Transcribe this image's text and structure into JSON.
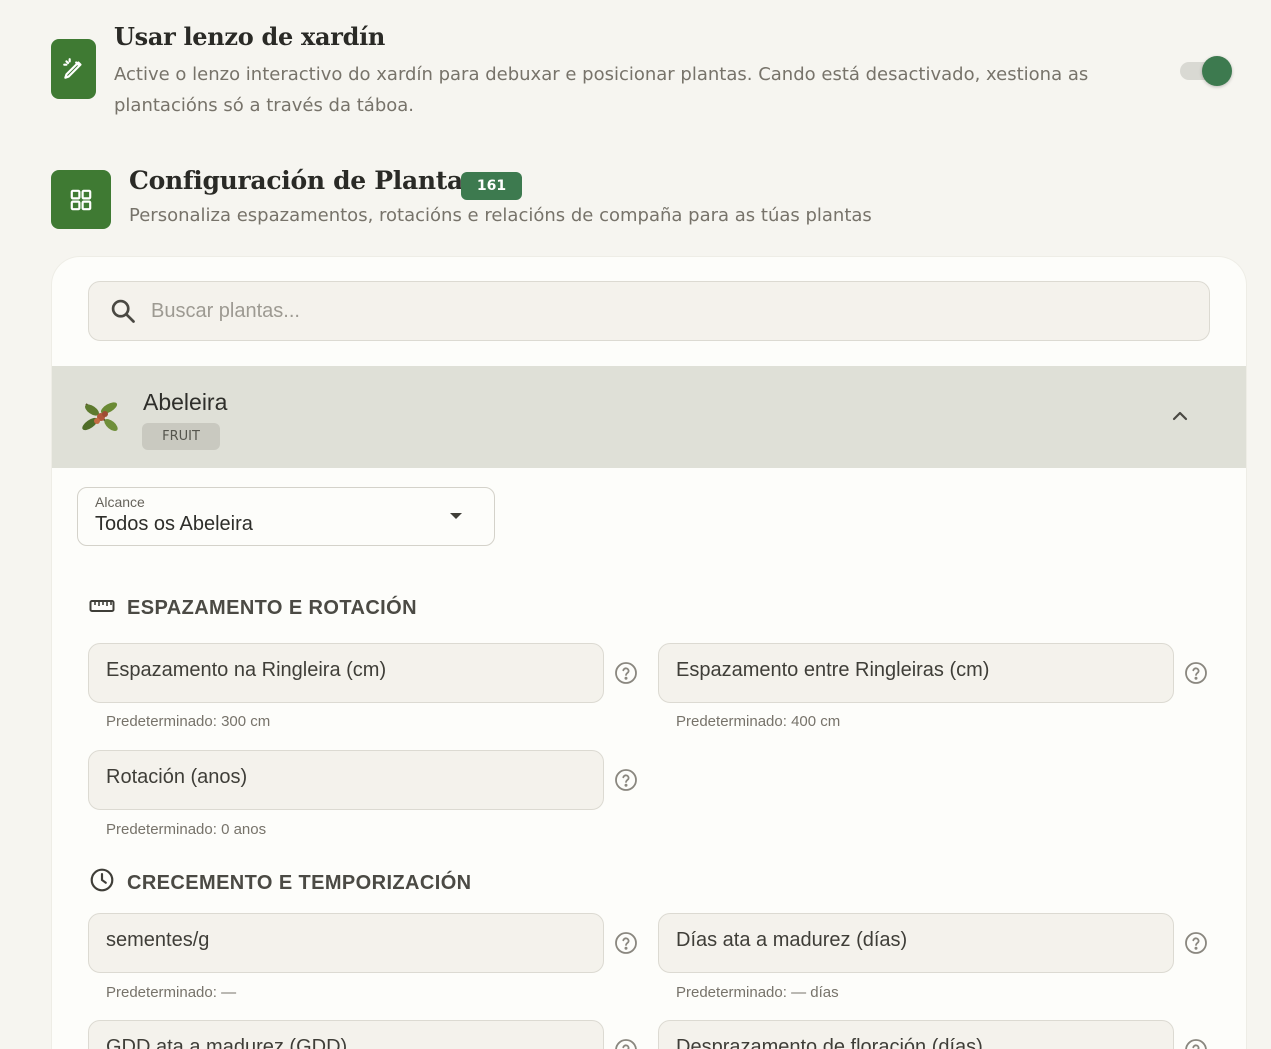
{
  "canvas_setting": {
    "title": "Usar lenzo de xardín",
    "description": "Active o lenzo interactivo do xardín para debuxar e posicionar plantas. Cando está desactivado, xestiona as plantacións só a través da táboa.",
    "enabled": true
  },
  "plant_config": {
    "title": "Configuración de Plantas",
    "count": "161",
    "subtitle": "Personaliza espazamentos, rotacións e relacións de compaña para as túas plantas",
    "search_placeholder": "Buscar plantas..."
  },
  "plant": {
    "name": "Abeleira",
    "category": "FRUIT"
  },
  "scope": {
    "label": "Alcance",
    "value": "Todos os Abeleira"
  },
  "spacing_section": {
    "heading": "ESPAZAMENTO E ROTACIÓN",
    "fields": [
      {
        "label": "Espazamento na Ringleira (cm)",
        "hint": "Predeterminado: 300 cm"
      },
      {
        "label": "Espazamento entre Ringleiras (cm)",
        "hint": "Predeterminado: 400 cm"
      },
      {
        "label": "Rotación (anos)",
        "hint": "Predeterminado: 0 anos"
      }
    ]
  },
  "growth_section": {
    "heading": "CRECEMENTO E TEMPORIZACIÓN",
    "fields": [
      {
        "label": "sementes/g",
        "hint": "Predeterminado: —"
      },
      {
        "label": "Días ata a madurez (días)",
        "hint": "Predeterminado: — días"
      },
      {
        "label": "GDD ata a madurez (GDD)",
        "hint": ""
      },
      {
        "label": "Desprazamento de floración (días)",
        "hint": ""
      }
    ]
  },
  "colors": {
    "accent": "#3f7a33",
    "toggle_on": "#3d7a4f",
    "badge": "#3d7a4f"
  },
  "icons": {
    "canvas": "pencil-sparkle-icon",
    "plants": "grid-icon",
    "search": "search-icon",
    "collapse": "chevron-up-icon",
    "dropdown": "caret-down-icon",
    "spacing": "ruler-icon",
    "growth": "clock-icon",
    "help": "help-circle-icon"
  }
}
